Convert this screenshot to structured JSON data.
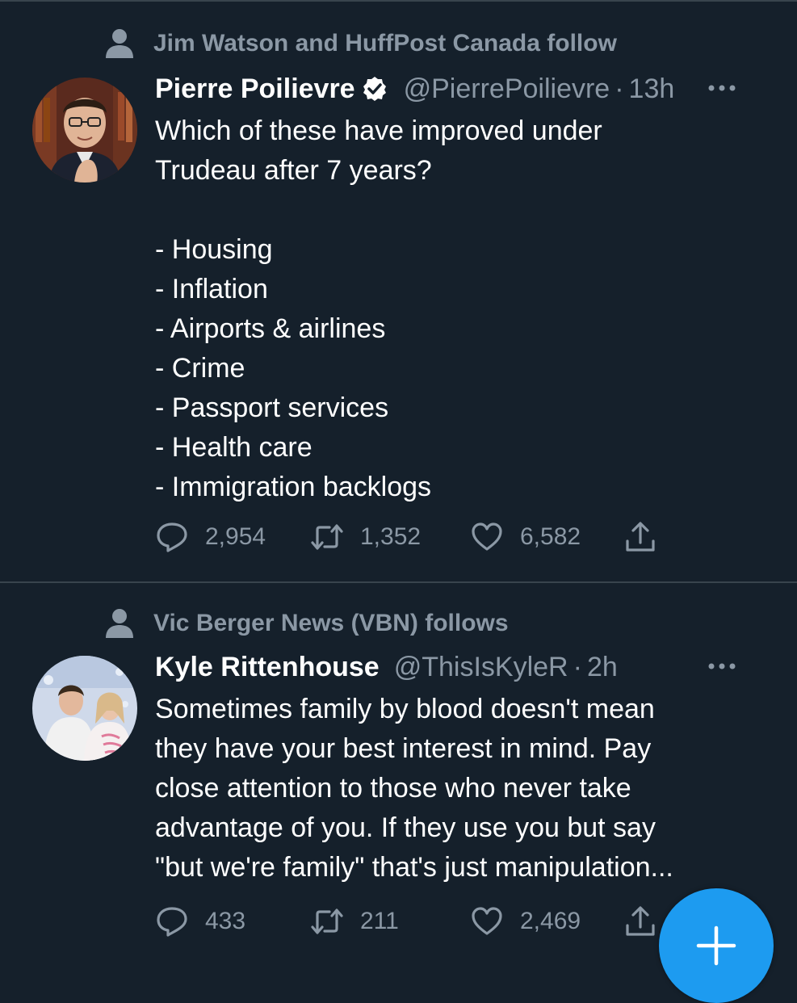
{
  "tweets": [
    {
      "social_context": "Jim Watson and HuffPost Canada follow",
      "display_name": "Pierre Poilievre",
      "verified": true,
      "handle": "@PierrePoilievre",
      "separator": "·",
      "time": "13h",
      "text_lines": [
        "Which of these have improved under",
        "Trudeau after 7 years?",
        "",
        "- Housing",
        "- Inflation",
        "- Airports & airlines",
        "- Crime",
        "- Passport services",
        "- Health care",
        "- Immigration backlogs"
      ],
      "replies": "2,954",
      "retweets": "1,352",
      "likes": "6,582",
      "icons": [
        "person-icon",
        "verified-badge-icon",
        "more-icon",
        "reply-icon",
        "retweet-icon",
        "like-icon",
        "share-icon"
      ]
    },
    {
      "social_context": "Vic Berger News (VBN) follows",
      "display_name": "Kyle Rittenhouse",
      "verified": false,
      "handle": "@ThisIsKyleR",
      "separator": "·",
      "time": "2h",
      "text_lines": [
        "Sometimes family by blood doesn't mean",
        "they have your best interest in mind. Pay",
        "close attention to those who never take",
        "advantage of you. If they use you but say",
        "\"but we're family\" that's just manipulation..."
      ],
      "replies": "433",
      "retweets": "211",
      "likes": "2,469",
      "icons": [
        "person-icon",
        "more-icon",
        "reply-icon",
        "retweet-icon",
        "like-icon",
        "share-icon"
      ]
    }
  ],
  "compose_button": {
    "icon": "plus-icon"
  },
  "colors": {
    "background": "#15202b",
    "text_primary": "#ffffff",
    "text_secondary": "#8b98a5",
    "divider": "#38444d",
    "accent": "#1d9bf0"
  }
}
